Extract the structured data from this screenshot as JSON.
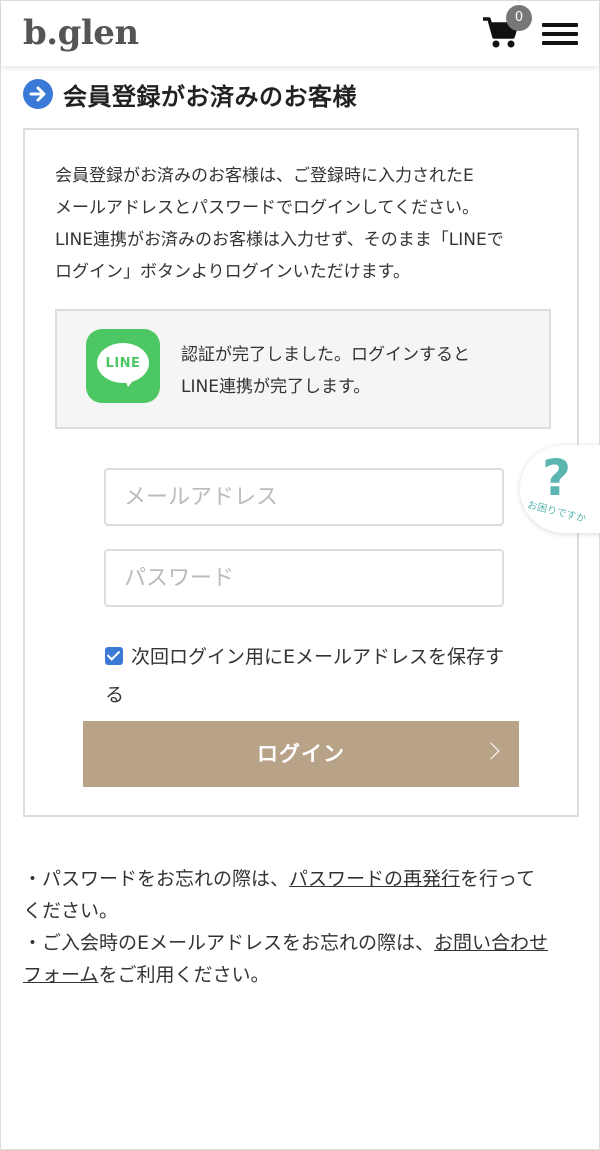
{
  "header": {
    "logo": "b.glen",
    "cart_count": "0"
  },
  "section": {
    "title": "会員登録がお済みのお客様"
  },
  "panel": {
    "intro_line1": "会員登録がお済みのお客様は、ご登録時に入力されたE",
    "intro_line2": "メールアドレスとパスワードでログインしてください。",
    "intro_line3": "LINE連携がお済みのお客様は入力せず、そのまま「LINEで",
    "intro_line4": "ログイン」ボタンよりログインいただけます。",
    "line_logo_text": "LINE",
    "line_msg_line1": "認証が完了しました。ログインすると",
    "line_msg_line2": "LINE連携が完了します。",
    "email_placeholder": "メールアドレス",
    "password_placeholder": "パスワード",
    "save_label_line1": "次回ログイン用にEメールアドレスを保存す",
    "save_label_line2": "る",
    "save_checked": true,
    "login_label": "ログイン"
  },
  "help": {
    "symbol": "?",
    "label": "お困りですか"
  },
  "notes": {
    "line1_prefix": "・パスワードをお忘れの際は、",
    "line1_link": "パスワードの再発行",
    "line1_suffix": "を行って",
    "line2": "ください。",
    "line3_prefix": "・ご入会時のEメールアドレスをお忘れの際は、",
    "line3_link_a": "お問い合わせ",
    "line4_link_b": "フォーム",
    "line4_suffix": "をご利用ください。"
  },
  "colors": {
    "accent_blue": "#3a7ad6",
    "login_button": "#b8a288",
    "line_green": "#4cc764",
    "help_teal": "#5bb6b1"
  }
}
